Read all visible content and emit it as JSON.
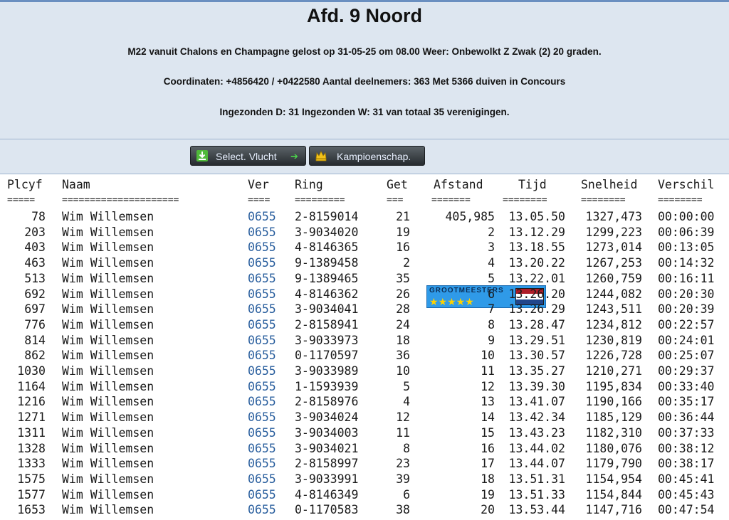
{
  "header": {
    "title": "Afd. 9 Noord",
    "info_line1": "M22 vanuit Chalons en Champagne gelost op 31-05-25 om 08.00 Weer: Onbewolkt Z Zwak (2) 20 graden.",
    "info_line2": "Coordinaten: +4856420 / +0422580 Aantal deelnemers: 363 Met 5366 duiven in Concours",
    "info_line3": "Ingezonden D: 31 Ingezonden W: 31 van totaal 35 verenigingen."
  },
  "toolbar": {
    "select_label": "Select. Vlucht",
    "kampioen_label": "Kampioenschap.",
    "banner_text": "GROOTMEESTERS",
    "banner_stars": "★★★★★"
  },
  "colors": {
    "header_bg": "#dde6f0",
    "link_blue": "#2a5f9e",
    "flag_red": "#ae1c28",
    "flag_white": "#ffffff",
    "flag_blue": "#21468b"
  },
  "table": {
    "columns": [
      "Plcyf",
      "Naam",
      "Ver",
      "Ring",
      "Get",
      "Afstand",
      "Tijd",
      "Snelheid",
      "Verschil"
    ],
    "separators": [
      "=====",
      "=====================",
      "====",
      "=========",
      "===",
      "=======",
      "========",
      "========",
      "========"
    ],
    "rows": [
      [
        "78",
        "Wim Willemsen",
        "0655",
        "2-8159014",
        "21",
        "405,985",
        "13.05.50",
        "1327,473",
        "00:00:00"
      ],
      [
        "203",
        "Wim Willemsen",
        "0655",
        "3-9034020",
        "19",
        "2",
        "13.12.29",
        "1299,223",
        "00:06:39"
      ],
      [
        "403",
        "Wim Willemsen",
        "0655",
        "4-8146365",
        "16",
        "3",
        "13.18.55",
        "1273,014",
        "00:13:05"
      ],
      [
        "463",
        "Wim Willemsen",
        "0655",
        "9-1389458",
        "2",
        "4",
        "13.20.22",
        "1267,253",
        "00:14:32"
      ],
      [
        "513",
        "Wim Willemsen",
        "0655",
        "9-1389465",
        "35",
        "5",
        "13.22.01",
        "1260,759",
        "00:16:11"
      ],
      [
        "692",
        "Wim Willemsen",
        "0655",
        "4-8146362",
        "26",
        "6",
        "13.26.20",
        "1244,082",
        "00:20:30"
      ],
      [
        "697",
        "Wim Willemsen",
        "0655",
        "3-9034041",
        "28",
        "7",
        "13.26.29",
        "1243,511",
        "00:20:39"
      ],
      [
        "776",
        "Wim Willemsen",
        "0655",
        "2-8158941",
        "24",
        "8",
        "13.28.47",
        "1234,812",
        "00:22:57"
      ],
      [
        "814",
        "Wim Willemsen",
        "0655",
        "3-9033973",
        "18",
        "9",
        "13.29.51",
        "1230,819",
        "00:24:01"
      ],
      [
        "862",
        "Wim Willemsen",
        "0655",
        "0-1170597",
        "36",
        "10",
        "13.30.57",
        "1226,728",
        "00:25:07"
      ],
      [
        "1030",
        "Wim Willemsen",
        "0655",
        "3-9033989",
        "10",
        "11",
        "13.35.27",
        "1210,271",
        "00:29:37"
      ],
      [
        "1164",
        "Wim Willemsen",
        "0655",
        "1-1593939",
        "5",
        "12",
        "13.39.30",
        "1195,834",
        "00:33:40"
      ],
      [
        "1216",
        "Wim Willemsen",
        "0655",
        "2-8158976",
        "4",
        "13",
        "13.41.07",
        "1190,166",
        "00:35:17"
      ],
      [
        "1271",
        "Wim Willemsen",
        "0655",
        "3-9034024",
        "12",
        "14",
        "13.42.34",
        "1185,129",
        "00:36:44"
      ],
      [
        "1311",
        "Wim Willemsen",
        "0655",
        "3-9034003",
        "11",
        "15",
        "13.43.23",
        "1182,310",
        "00:37:33"
      ],
      [
        "1328",
        "Wim Willemsen",
        "0655",
        "3-9034021",
        "8",
        "16",
        "13.44.02",
        "1180,076",
        "00:38:12"
      ],
      [
        "1333",
        "Wim Willemsen",
        "0655",
        "2-8158997",
        "23",
        "17",
        "13.44.07",
        "1179,790",
        "00:38:17"
      ],
      [
        "1575",
        "Wim Willemsen",
        "0655",
        "3-9033991",
        "39",
        "18",
        "13.51.31",
        "1154,954",
        "00:45:41"
      ],
      [
        "1577",
        "Wim Willemsen",
        "0655",
        "4-8146349",
        "6",
        "19",
        "13.51.33",
        "1154,844",
        "00:45:43"
      ],
      [
        "1653",
        "Wim Willemsen",
        "0655",
        "0-1170583",
        "38",
        "20",
        "13.53.44",
        "1147,716",
        "00:47:54"
      ]
    ]
  }
}
